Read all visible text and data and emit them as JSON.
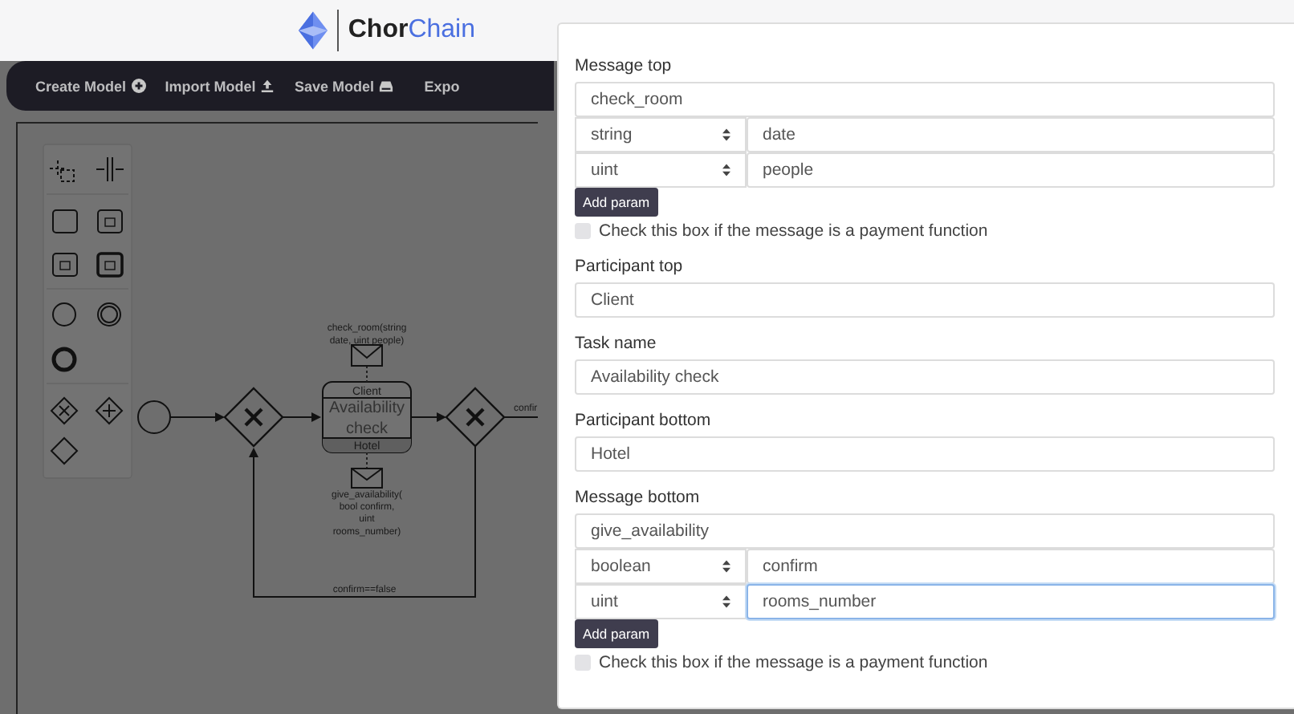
{
  "logo": {
    "bold": "Chor",
    "light": "Chain"
  },
  "nav": [
    {
      "label": "Create Model",
      "kind": "create"
    },
    {
      "label": "Import Model",
      "kind": "import"
    },
    {
      "label": "Save Model",
      "kind": "save"
    },
    {
      "label": "Expo",
      "kind": "export"
    }
  ],
  "diagram": {
    "message_top": [
      "check_room(string",
      "date, uint people)"
    ],
    "task_top": "Client",
    "task_name": [
      "Availability",
      "check"
    ],
    "task_bottom": "Hotel",
    "message_bottom": [
      "give_availability(",
      "bool confirm,",
      "uint",
      "rooms_number)"
    ],
    "loop_label": "confirm==false",
    "exit_label": "confir"
  },
  "form": [
    {
      "kind": "message",
      "label": "Message top",
      "value": "check_room",
      "params": [
        {
          "type": "string",
          "name": "date",
          "focused": false
        },
        {
          "type": "uint",
          "name": "people",
          "focused": false
        }
      ],
      "add_button": "Add param",
      "payment_label": "Check this box if the message is a payment function",
      "payment_checked": false
    },
    {
      "kind": "text",
      "label": "Participant top",
      "value": "Client"
    },
    {
      "kind": "text",
      "label": "Task name",
      "value": "Availability check"
    },
    {
      "kind": "text",
      "label": "Participant bottom",
      "value": "Hotel"
    },
    {
      "kind": "message",
      "label": "Message bottom",
      "value": "give_availability",
      "params": [
        {
          "type": "boolean",
          "name": "confirm",
          "focused": false
        },
        {
          "type": "uint",
          "name": "rooms_number",
          "focused": true
        }
      ],
      "add_button": "Add param",
      "payment_label": "Check this box if the message is a payment function",
      "payment_checked": false
    }
  ]
}
